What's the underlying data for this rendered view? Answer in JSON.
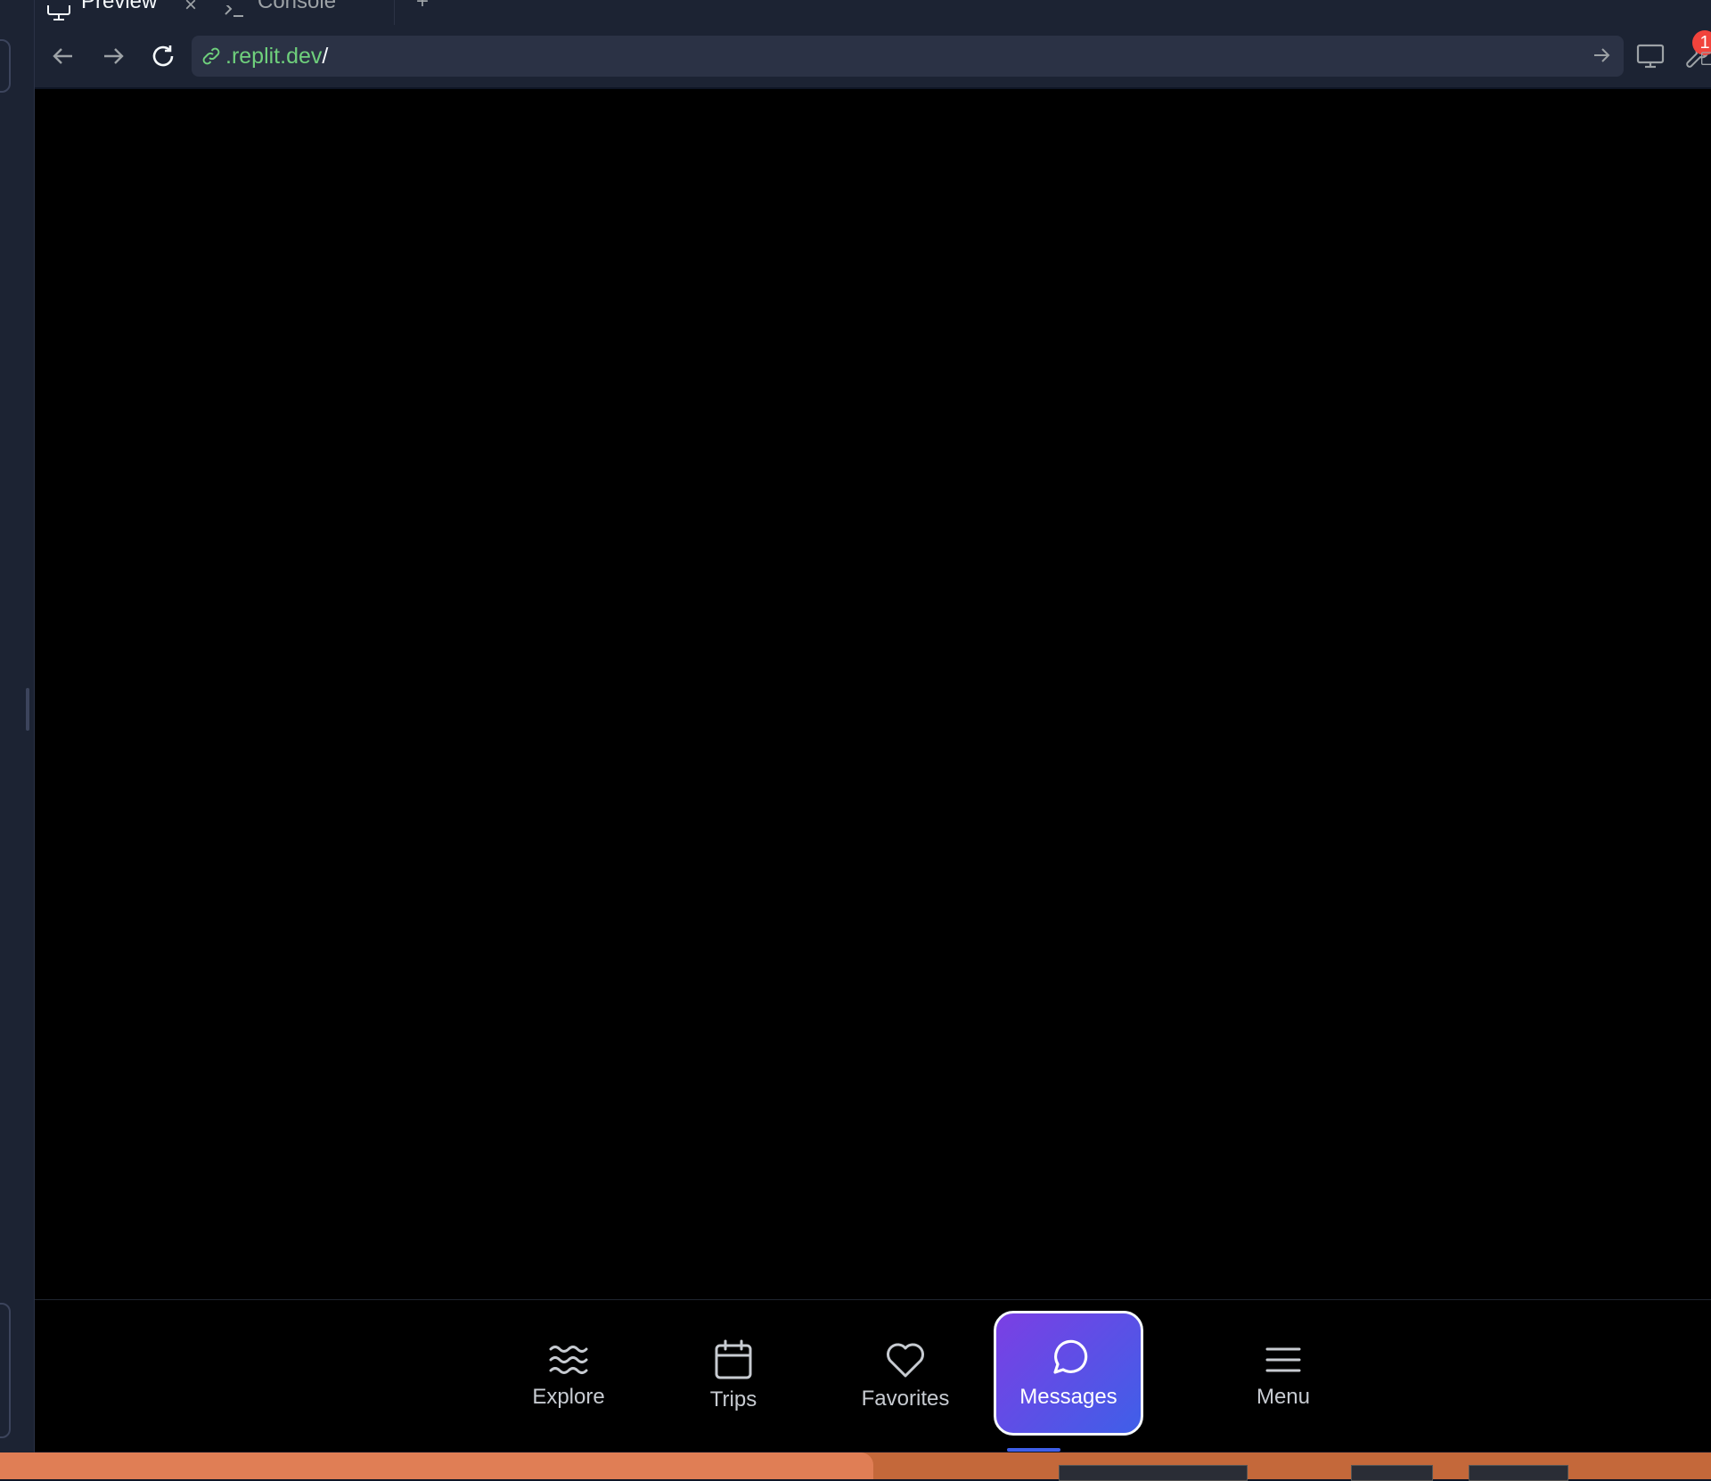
{
  "tabs": {
    "preview_label": "Preview",
    "console_label": "Console",
    "close_glyph": "×",
    "add_glyph": "+"
  },
  "url": {
    "host": ".replit.dev",
    "path": "/"
  },
  "toolbar": {
    "devtools_badge": "1"
  },
  "nav": {
    "items": [
      {
        "label": "Explore",
        "icon": "waves-icon"
      },
      {
        "label": "Trips",
        "icon": "calendar-icon"
      },
      {
        "label": "Favorites",
        "icon": "heart-icon"
      },
      {
        "label": "Messages",
        "icon": "chat-bubble-icon",
        "active": true
      },
      {
        "label": "Menu",
        "icon": "hamburger-menu-icon"
      }
    ]
  },
  "colors": {
    "accent_gradient_start": "#7b3fe4",
    "accent_gradient_end": "#3f5fe8",
    "url_host": "#6fd07c",
    "badge": "#f1433c"
  }
}
